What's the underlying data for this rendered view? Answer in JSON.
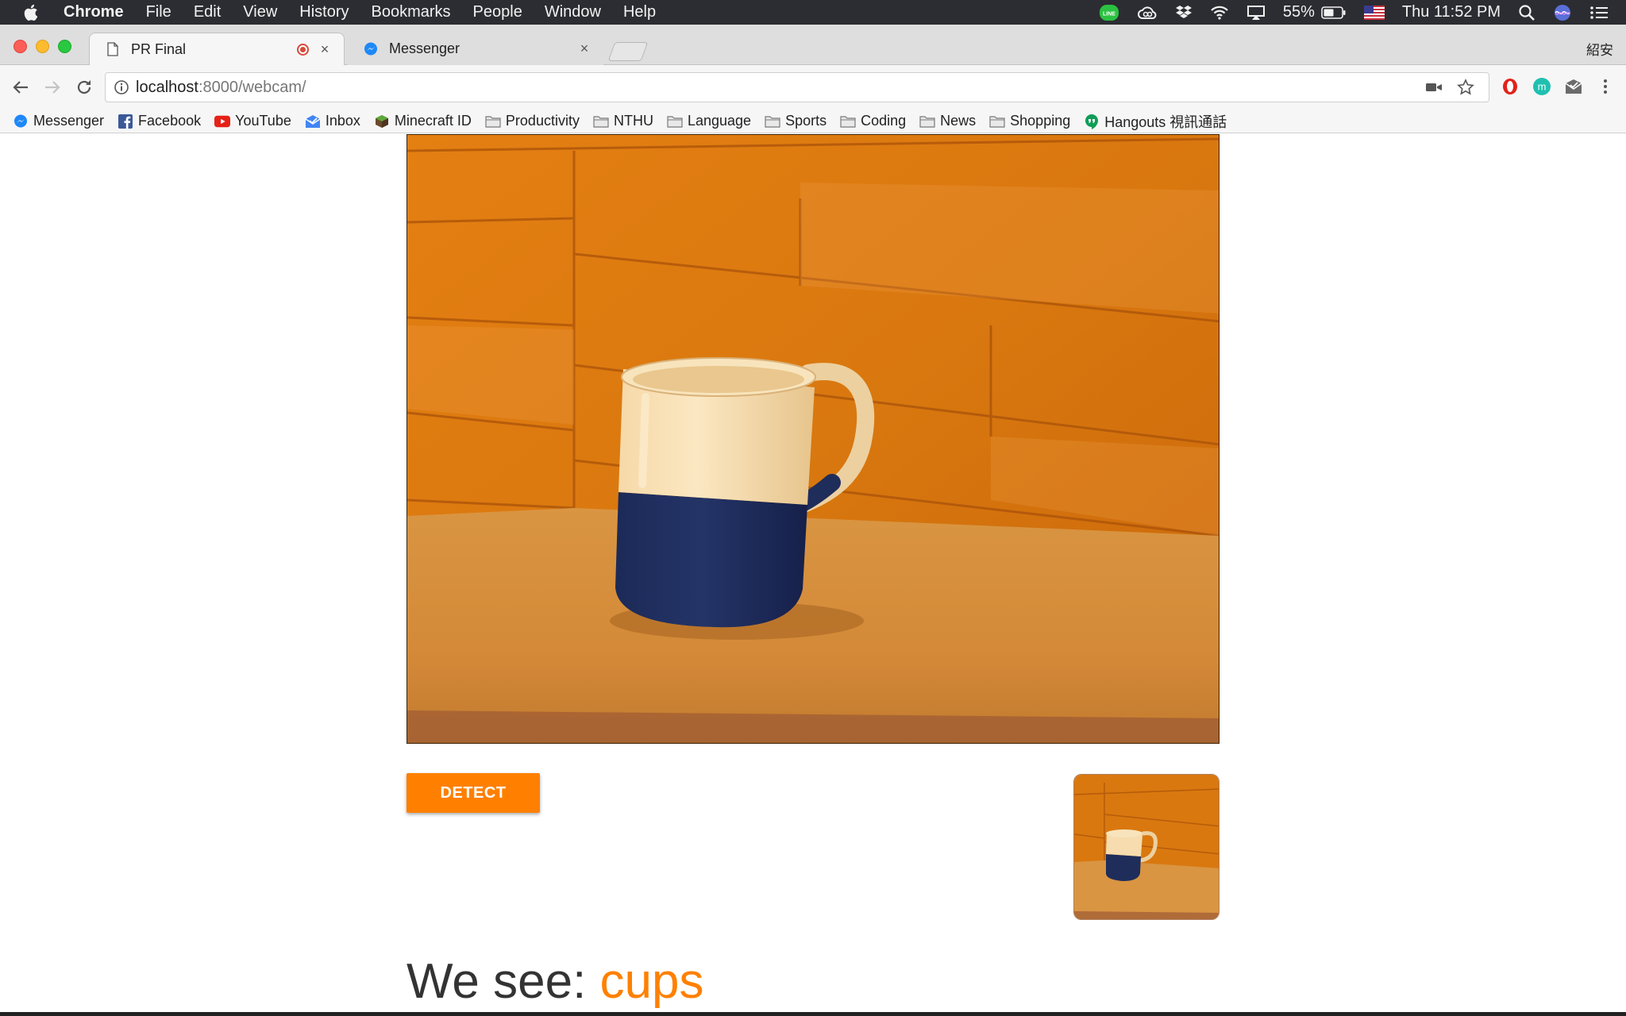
{
  "menubar": {
    "app_name": "Chrome",
    "items": [
      "File",
      "Edit",
      "View",
      "History",
      "Bookmarks",
      "People",
      "Window",
      "Help"
    ],
    "battery": "55%",
    "clock": "Thu 11:52 PM"
  },
  "tabs": [
    {
      "title": "PR Final",
      "icon": "document-icon",
      "recording": true
    },
    {
      "title": "Messenger",
      "icon": "messenger-icon",
      "recording": false
    }
  ],
  "tab_close_glyph": "×",
  "profile_name": "紹安",
  "omnibox": {
    "host": "localhost",
    "path": ":8000/webcam/"
  },
  "bookmarks": [
    {
      "label": "Messenger",
      "icon": "messenger-icon"
    },
    {
      "label": "Facebook",
      "icon": "facebook-icon"
    },
    {
      "label": "YouTube",
      "icon": "youtube-icon"
    },
    {
      "label": "Inbox",
      "icon": "inbox-icon"
    },
    {
      "label": "Minecraft ID",
      "icon": "minecraft-icon"
    },
    {
      "label": "Productivity",
      "icon": "folder-icon"
    },
    {
      "label": "NTHU",
      "icon": "folder-icon"
    },
    {
      "label": "Language",
      "icon": "folder-icon"
    },
    {
      "label": "Sports",
      "icon": "folder-icon"
    },
    {
      "label": "Coding",
      "icon": "folder-icon"
    },
    {
      "label": "News",
      "icon": "folder-icon"
    },
    {
      "label": "Shopping",
      "icon": "folder-icon"
    },
    {
      "label": "Hangouts 視訊通話",
      "icon": "hangouts-icon"
    }
  ],
  "page": {
    "detect_label": "DETECT",
    "result_prefix": "We see: ",
    "result_object": "cups"
  },
  "colors": {
    "accent": "#ff8000",
    "menubar_bg": "#2c2d32",
    "tabstrip_bg": "#dedede",
    "toolbar_bg": "#f6f6f6",
    "result_text": "#333333"
  }
}
